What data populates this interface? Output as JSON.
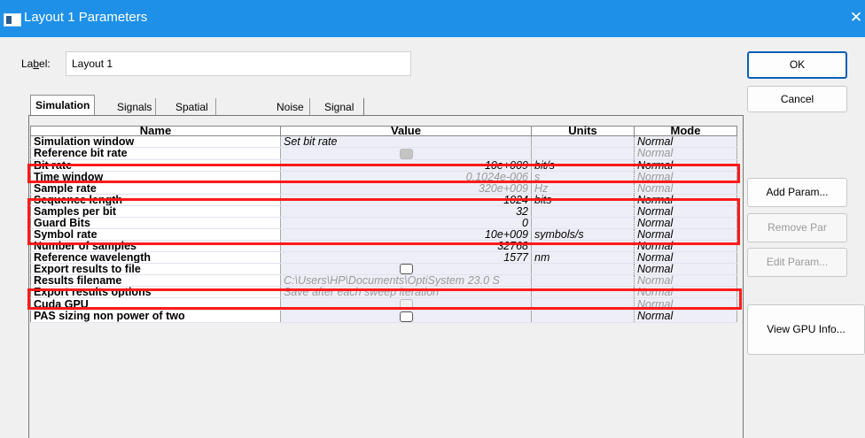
{
  "window": {
    "title": "Layout 1 Parameters",
    "close_glyph": "✕",
    "app_icon": "window-icon"
  },
  "label_field": {
    "label_prefix": "La",
    "label_underlined": "b",
    "label_suffix": "el:",
    "value": "Layout 1"
  },
  "buttons": {
    "ok": "OK",
    "cancel": "Cancel",
    "add_param": "Add Param...",
    "remove_par": "Remove Par",
    "edit_param": "Edit Param...",
    "view_gpu": "View GPU Info..."
  },
  "tabs": [
    {
      "label": "Simulation",
      "active": true
    },
    {
      "label": "Signals"
    },
    {
      "label": "Spatial effects"
    },
    {
      "label": "Noise"
    },
    {
      "label": "Signal tracing"
    }
  ],
  "table": {
    "headers": {
      "name": "Name",
      "value": "Value",
      "units": "Units",
      "mode": "Mode"
    },
    "rows": [
      {
        "name": "Simulation window",
        "value": "Set bit rate",
        "units": "",
        "mode": "Normal"
      },
      {
        "name": "Reference bit rate",
        "value": "",
        "units": "",
        "mode": "Normal",
        "control": "checkbox-checked-disabled"
      },
      {
        "name": "Bit rate",
        "value": "10e+009",
        "units": "bit/s",
        "mode": "Normal"
      },
      {
        "name": "Time window",
        "value": "0.1024e-006",
        "units": "s",
        "mode": "Normal"
      },
      {
        "name": "Sample rate",
        "value": "320e+009",
        "units": "Hz",
        "mode": "Normal"
      },
      {
        "name": "Sequence length",
        "value": "1024",
        "units": "bits",
        "mode": "Normal"
      },
      {
        "name": "Samples per bit",
        "value": "32",
        "units": "",
        "mode": "Normal"
      },
      {
        "name": "Guard Bits",
        "value": "0",
        "units": "",
        "mode": "Normal"
      },
      {
        "name": "Symbol rate",
        "value": "10e+009",
        "units": "symbols/s",
        "mode": "Normal"
      },
      {
        "name": "Number of samples",
        "value": "32768",
        "units": "",
        "mode": "Normal"
      },
      {
        "name": "Reference wavelength",
        "value": "1577",
        "units": "nm",
        "mode": "Normal"
      },
      {
        "name": "Export results to file",
        "value": "",
        "units": "",
        "mode": "Normal",
        "control": "checkbox-unchecked"
      },
      {
        "name": "Results filename",
        "value": "C:\\Users\\HP\\Documents\\OptiSystem 23.0 S",
        "units": "",
        "mode": "Normal"
      },
      {
        "name": "Export results options",
        "value": "Save after each sweep iteration",
        "units": "",
        "mode": "Normal"
      },
      {
        "name": "Cuda GPU",
        "value": "",
        "units": "",
        "mode": "Normal",
        "control": "checkbox-disabled"
      },
      {
        "name": "PAS sizing non power of two",
        "value": "",
        "units": "",
        "mode": "Normal",
        "control": "checkbox-unchecked"
      }
    ]
  },
  "colors": {
    "titlebar": "#1e90e8",
    "highlight": "#ff1a1a",
    "value_bg": "#eeeef7"
  }
}
